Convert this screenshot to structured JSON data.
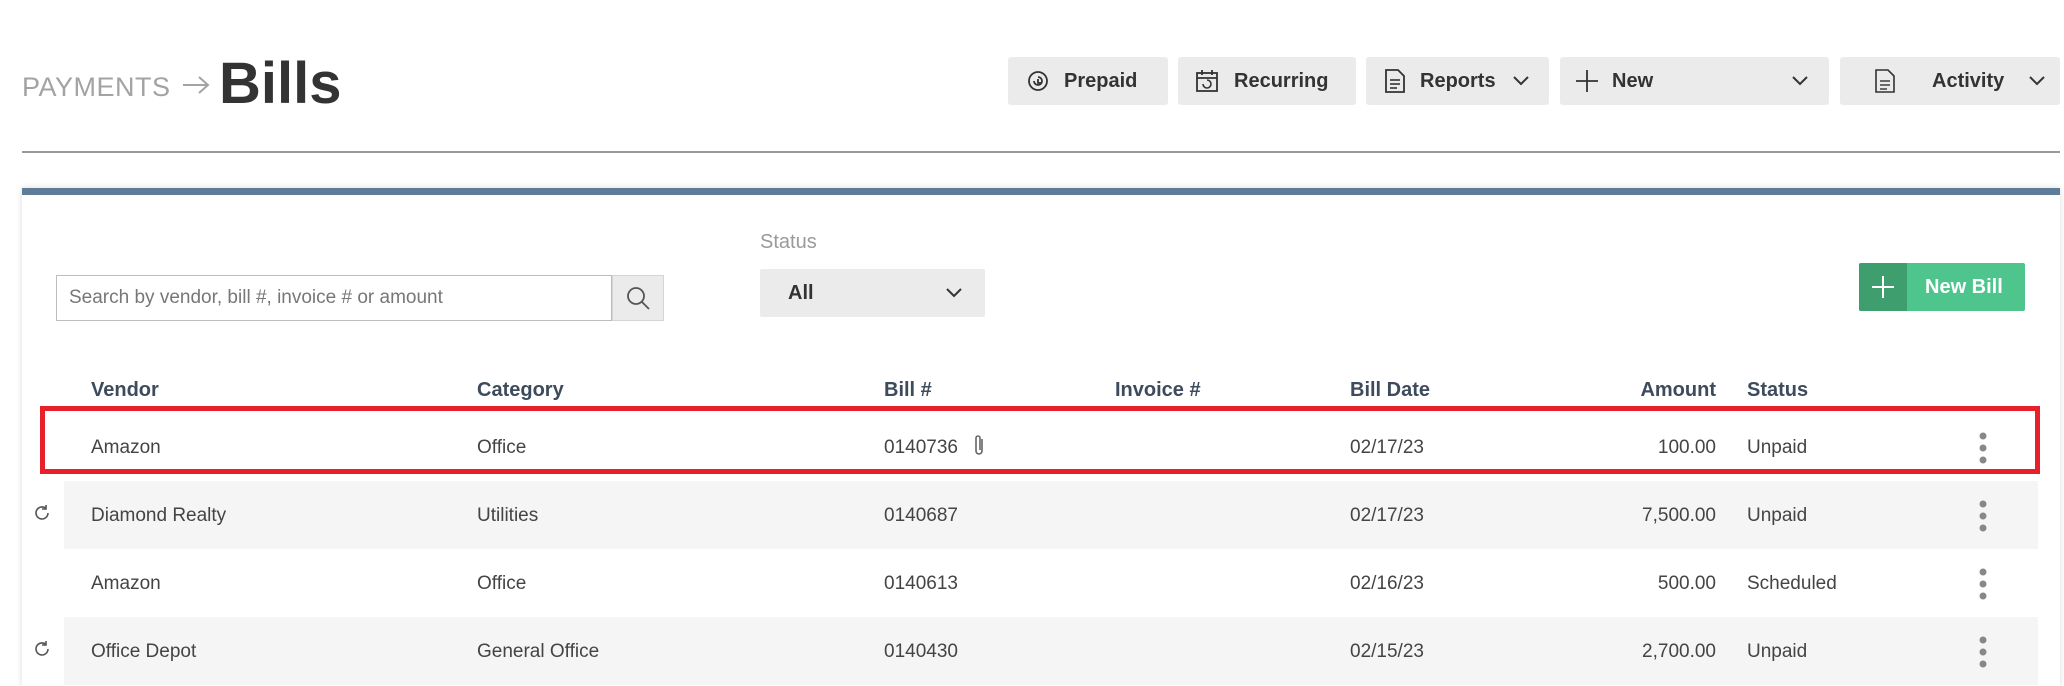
{
  "header": {
    "breadcrumb": "PAYMENTS",
    "title": "Bills"
  },
  "toolbar": {
    "prepaid": "Prepaid",
    "recurring": "Recurring",
    "reports": "Reports",
    "new": "New",
    "activity": "Activity"
  },
  "filters": {
    "search_placeholder": "Search by vendor, bill #, invoice # or amount",
    "search_value": "",
    "status_label": "Status",
    "status_value": "All",
    "new_bill": "New Bill"
  },
  "table": {
    "columns": {
      "vendor": "Vendor",
      "category": "Category",
      "bill": "Bill #",
      "invoice": "Invoice #",
      "date": "Bill Date",
      "amount": "Amount",
      "status": "Status"
    },
    "rows": [
      {
        "vendor": "Amazon",
        "category": "Office",
        "bill": "0140736",
        "invoice": "",
        "date": "02/17/23",
        "amount": "100.00",
        "status": "Unpaid",
        "attachment": true,
        "recurring": false
      },
      {
        "vendor": "Diamond Realty",
        "category": "Utilities",
        "bill": "0140687",
        "invoice": "",
        "date": "02/17/23",
        "amount": "7,500.00",
        "status": "Unpaid",
        "attachment": false,
        "recurring": true
      },
      {
        "vendor": "Amazon",
        "category": "Office",
        "bill": "0140613",
        "invoice": "",
        "date": "02/16/23",
        "amount": "500.00",
        "status": "Scheduled",
        "attachment": false,
        "recurring": false
      },
      {
        "vendor": "Office Depot",
        "category": "General Office",
        "bill": "0140430",
        "invoice": "",
        "date": "02/15/23",
        "amount": "2,700.00",
        "status": "Unpaid",
        "attachment": false,
        "recurring": true
      }
    ]
  },
  "colors": {
    "accent_bar": "#5f7d98",
    "new_bill_green": "#4fc58e",
    "highlight_red": "#e8202a"
  }
}
